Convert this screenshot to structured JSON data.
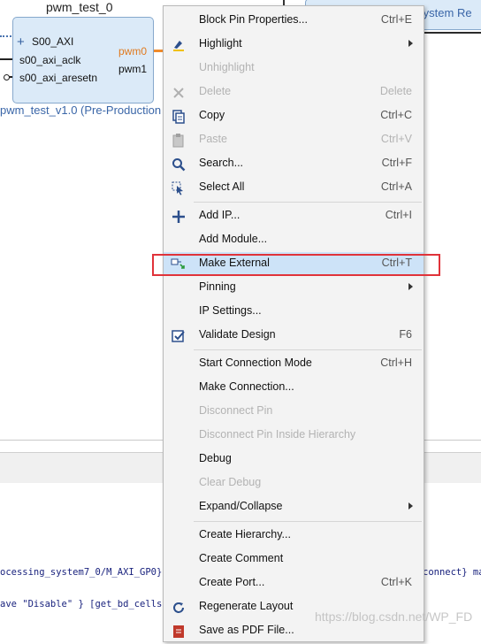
{
  "canvas": {
    "instance_name": "pwm_test_0",
    "ports_in": [
      "S00_AXI",
      "s00_axi_aclk",
      "s00_axi_aresetn"
    ],
    "ports_out": [
      "pwm0",
      "pwm1"
    ],
    "footer": "pwm_test_v1.0 (Pre-Production",
    "neighbor_block": "System Re",
    "colors": {
      "block_fill": "#dbeaf8",
      "block_border": "#86a8cc",
      "out_port_highlight": "#e07a1f",
      "footer_text": "#3a66a8"
    }
  },
  "context_menu": {
    "groups": [
      [
        {
          "label": "Block Pin Properties...",
          "shortcut": "Ctrl+E",
          "icon": "none",
          "enabled": true
        },
        {
          "label": "Highlight",
          "shortcut": "",
          "icon": "highlighter-icon",
          "enabled": true,
          "submenu": true
        },
        {
          "label": "Unhighlight",
          "shortcut": "",
          "icon": "none",
          "enabled": false
        },
        {
          "label": "Delete",
          "shortcut": "Delete",
          "icon": "delete-x-icon",
          "enabled": false
        },
        {
          "label": "Copy",
          "shortcut": "Ctrl+C",
          "icon": "copy-icon",
          "enabled": true
        },
        {
          "label": "Paste",
          "shortcut": "Ctrl+V",
          "icon": "paste-icon",
          "enabled": false
        },
        {
          "label": "Search...",
          "shortcut": "Ctrl+F",
          "icon": "search-icon",
          "enabled": true
        },
        {
          "label": "Select All",
          "shortcut": "Ctrl+A",
          "icon": "select-all-icon",
          "enabled": true
        }
      ],
      [
        {
          "label": "Add IP...",
          "shortcut": "Ctrl+I",
          "icon": "add-icon",
          "enabled": true
        },
        {
          "label": "Add Module...",
          "shortcut": "",
          "icon": "none",
          "enabled": true
        },
        {
          "label": "Make External",
          "shortcut": "Ctrl+T",
          "icon": "make-external-icon",
          "enabled": true,
          "highlighted": true
        },
        {
          "label": "Pinning",
          "shortcut": "",
          "icon": "none",
          "enabled": true,
          "submenu": true
        },
        {
          "label": "IP Settings...",
          "shortcut": "",
          "icon": "none",
          "enabled": true
        },
        {
          "label": "Validate Design",
          "shortcut": "F6",
          "icon": "validate-checkbox-icon",
          "enabled": true
        }
      ],
      [
        {
          "label": "Start Connection Mode",
          "shortcut": "Ctrl+H",
          "icon": "none",
          "enabled": true
        },
        {
          "label": "Make Connection...",
          "shortcut": "",
          "icon": "none",
          "enabled": true
        },
        {
          "label": "Disconnect Pin",
          "shortcut": "",
          "icon": "none",
          "enabled": false
        },
        {
          "label": "Disconnect Pin Inside Hierarchy",
          "shortcut": "",
          "icon": "none",
          "enabled": false
        },
        {
          "label": "Debug",
          "shortcut": "",
          "icon": "none",
          "enabled": true
        },
        {
          "label": "Clear Debug",
          "shortcut": "",
          "icon": "none",
          "enabled": false
        },
        {
          "label": "Expand/Collapse",
          "shortcut": "",
          "icon": "none",
          "enabled": true,
          "submenu": true
        }
      ],
      [
        {
          "label": "Create Hierarchy...",
          "shortcut": "",
          "icon": "none",
          "enabled": true
        },
        {
          "label": "Create Comment",
          "shortcut": "",
          "icon": "none",
          "enabled": true
        },
        {
          "label": "Create Port...",
          "shortcut": "Ctrl+K",
          "icon": "none",
          "enabled": true
        },
        {
          "label": "Regenerate Layout",
          "shortcut": "",
          "icon": "regenerate-icon",
          "enabled": true
        },
        {
          "label": "Save as PDF File...",
          "shortcut": "",
          "icon": "pdf-icon",
          "enabled": true
        }
      ]
    ],
    "colors": {
      "background": "#f3f3f3",
      "highlight": "#cde3f8",
      "disabled_text": "#b3b3b3",
      "annotation_red": "#e0333a"
    }
  },
  "console": {
    "line1_left": "ocessing_system7_0/M_AXI_GP0} S",
    "line1_right": "connect} ma",
    "line2_left": "ave \"Disable\" }  [get_bd_cells"
  },
  "watermark": "https://blog.csdn.net/WP_FD"
}
